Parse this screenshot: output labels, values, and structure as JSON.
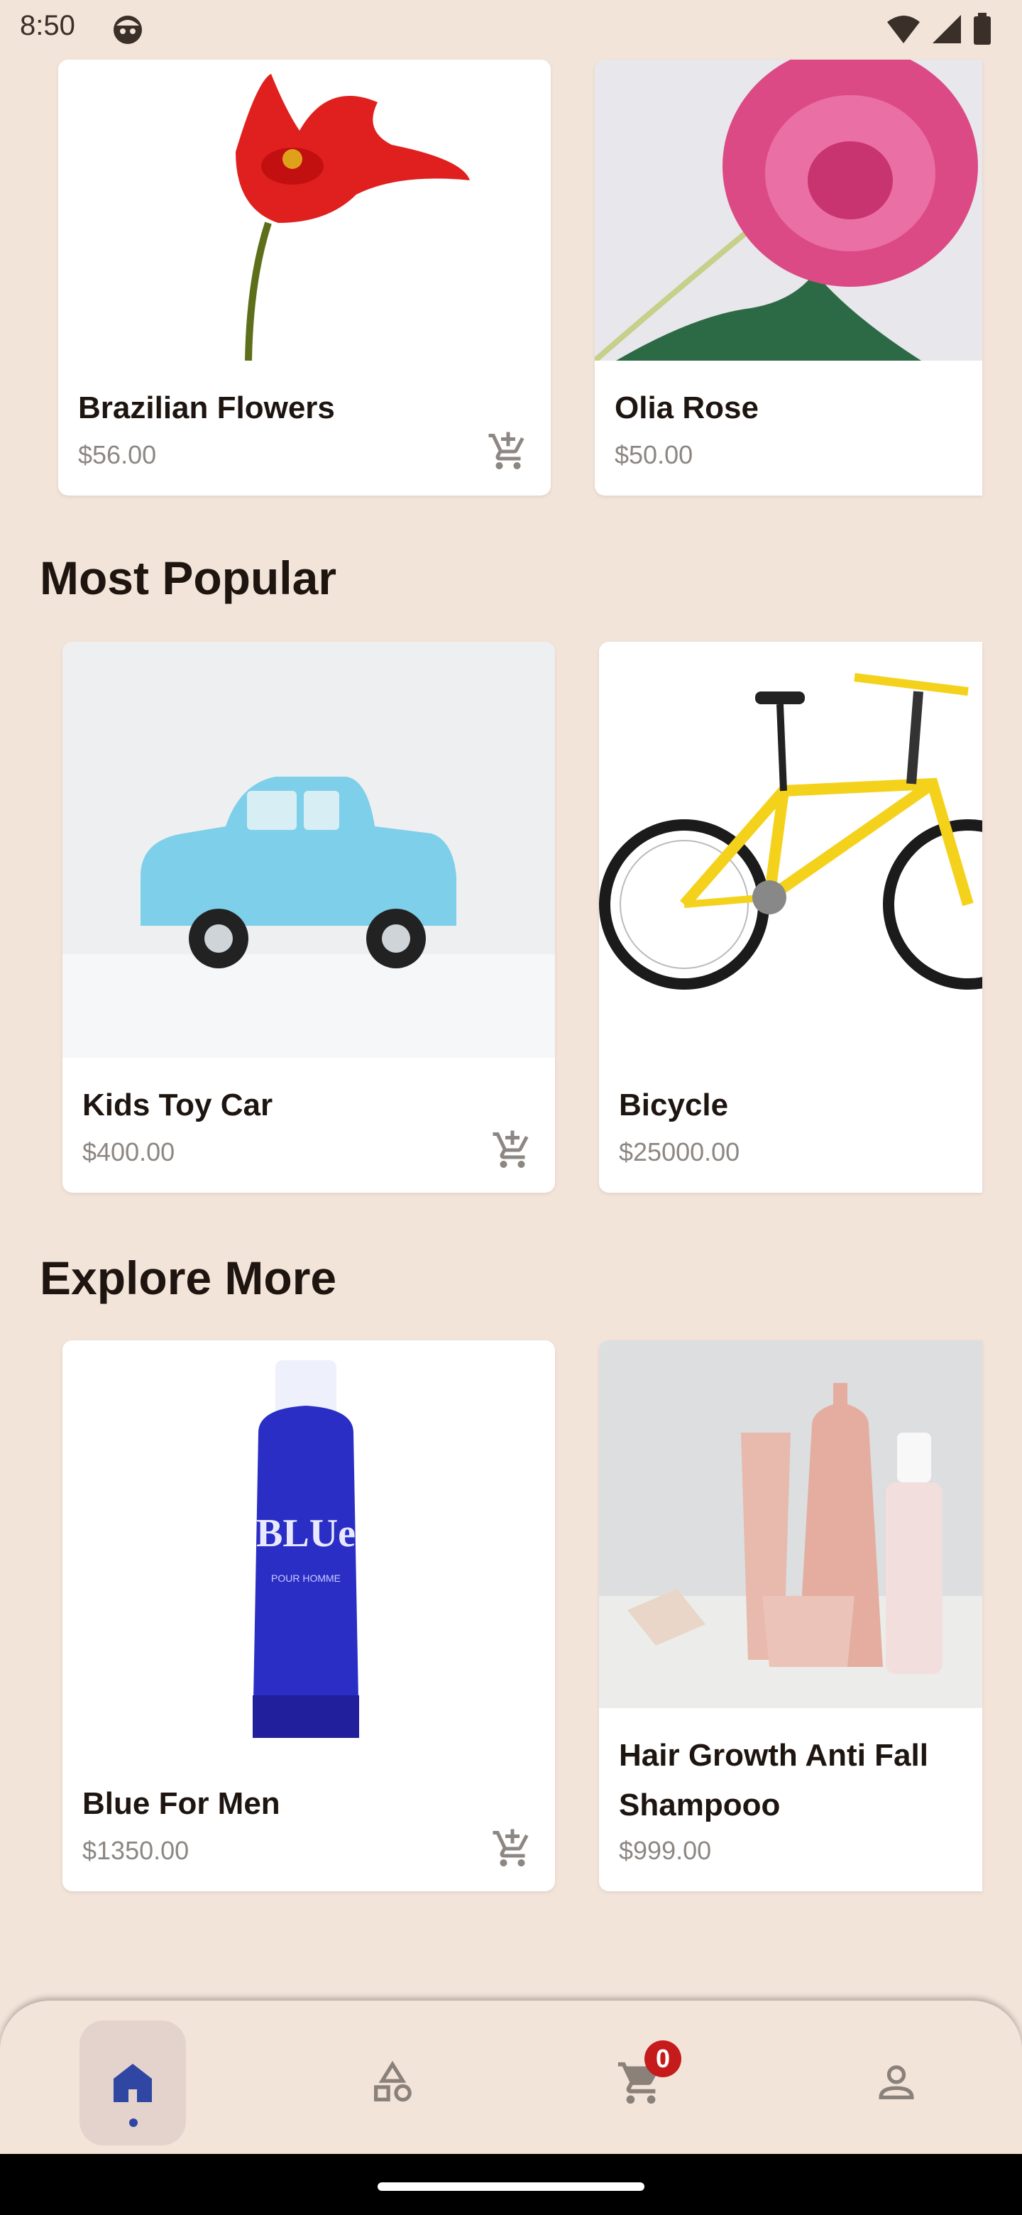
{
  "status": {
    "time": "8:50"
  },
  "featured": [
    {
      "name": "Brazilian Flowers",
      "price": "$56.00"
    },
    {
      "name": "Olia Rose",
      "price": "$50.00"
    }
  ],
  "most_popular": {
    "title": "Most Popular",
    "items": [
      {
        "name": "Kids Toy Car",
        "price": "$400.00"
      },
      {
        "name": "Bicycle",
        "price": "$25000.00"
      }
    ]
  },
  "explore_more": {
    "title": "Explore More",
    "items": [
      {
        "name": "Blue For Men",
        "price": "$1350.00",
        "bottle_text_1": "BLUe",
        "bottle_text_2": "POUR HOMME"
      },
      {
        "name": "Hair Growth Anti Fall Shampooo",
        "price": "$999.00"
      }
    ]
  },
  "nav": {
    "items": [
      "home-icon",
      "categories-icon",
      "cart-icon",
      "profile-icon"
    ],
    "cart_count": "0"
  },
  "colors": {
    "background": "#f3e4d9",
    "accent": "#2f46a3",
    "badge": "#c51b1b"
  }
}
